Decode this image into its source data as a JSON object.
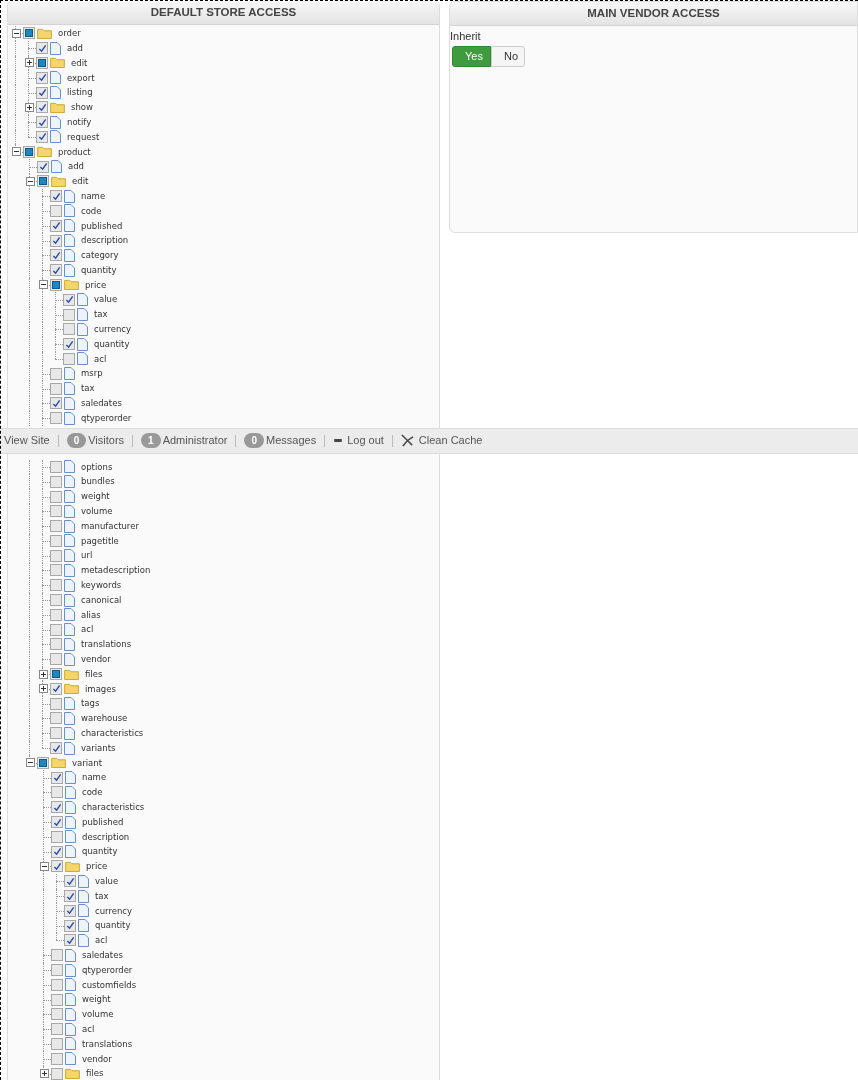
{
  "left_panel": {
    "title": "DEFAULT STORE ACCESS"
  },
  "tree": [
    {
      "kind": "folder",
      "label": "order",
      "checked": false,
      "partial": true,
      "expanded": true,
      "children": [
        {
          "kind": "file",
          "label": "add",
          "checked": true,
          "partial": false
        },
        {
          "kind": "folder",
          "label": "edit",
          "checked": false,
          "partial": true,
          "expanded": false
        },
        {
          "kind": "file",
          "label": "export",
          "checked": true,
          "partial": false
        },
        {
          "kind": "file",
          "label": "listing",
          "checked": true,
          "partial": false
        },
        {
          "kind": "folder",
          "label": "show",
          "checked": true,
          "partial": false,
          "expanded": false
        },
        {
          "kind": "file",
          "label": "notify",
          "checked": true,
          "partial": false
        },
        {
          "kind": "file",
          "label": "request",
          "checked": true,
          "partial": false
        }
      ]
    },
    {
      "kind": "folder",
      "label": "product",
      "checked": false,
      "partial": true,
      "expanded": true,
      "children": [
        {
          "kind": "file",
          "label": "add",
          "checked": true,
          "partial": false
        },
        {
          "kind": "folder",
          "label": "edit",
          "checked": false,
          "partial": true,
          "expanded": true,
          "children": [
            {
              "kind": "file",
              "label": "name",
              "checked": true,
              "partial": false
            },
            {
              "kind": "file",
              "label": "code",
              "checked": false,
              "partial": false
            },
            {
              "kind": "file",
              "label": "published",
              "checked": true,
              "partial": false
            },
            {
              "kind": "file",
              "label": "description",
              "checked": true,
              "partial": false
            },
            {
              "kind": "file",
              "label": "category",
              "checked": true,
              "partial": false
            },
            {
              "kind": "file",
              "label": "quantity",
              "checked": true,
              "partial": false
            },
            {
              "kind": "folder",
              "label": "price",
              "checked": false,
              "partial": true,
              "expanded": true,
              "children": [
                {
                  "kind": "file",
                  "label": "value",
                  "checked": true,
                  "partial": false
                },
                {
                  "kind": "file",
                  "label": "tax",
                  "checked": false,
                  "partial": false
                },
                {
                  "kind": "file",
                  "label": "currency",
                  "checked": false,
                  "partial": false
                },
                {
                  "kind": "file",
                  "label": "quantity",
                  "checked": true,
                  "partial": false
                },
                {
                  "kind": "file",
                  "label": "acl",
                  "checked": false,
                  "partial": false
                }
              ]
            },
            {
              "kind": "file",
              "label": "msrp",
              "checked": false,
              "partial": false
            },
            {
              "kind": "file",
              "label": "tax",
              "checked": false,
              "partial": false
            },
            {
              "kind": "file",
              "label": "saledates",
              "checked": true,
              "partial": false
            },
            {
              "kind": "file",
              "label": "qtyperorder",
              "checked": false,
              "partial": false
            },
            {
              "kind": "file",
              "label": "options",
              "checked": false,
              "partial": false
            },
            {
              "kind": "file",
              "label": "bundles",
              "checked": false,
              "partial": false
            },
            {
              "kind": "file",
              "label": "weight",
              "checked": false,
              "partial": false
            },
            {
              "kind": "file",
              "label": "volume",
              "checked": false,
              "partial": false
            },
            {
              "kind": "file",
              "label": "manufacturer",
              "checked": false,
              "partial": false
            },
            {
              "kind": "file",
              "label": "pagetitle",
              "checked": false,
              "partial": false
            },
            {
              "kind": "file",
              "label": "url",
              "checked": false,
              "partial": false
            },
            {
              "kind": "file",
              "label": "metadescription",
              "checked": false,
              "partial": false
            },
            {
              "kind": "file",
              "label": "keywords",
              "checked": false,
              "partial": false
            },
            {
              "kind": "file",
              "label": "canonical",
              "checked": false,
              "partial": false
            },
            {
              "kind": "file",
              "label": "alias",
              "checked": false,
              "partial": false
            },
            {
              "kind": "file",
              "label": "acl",
              "checked": false,
              "partial": false
            },
            {
              "kind": "file",
              "label": "translations",
              "checked": false,
              "partial": false
            },
            {
              "kind": "file",
              "label": "vendor",
              "checked": false,
              "partial": false
            },
            {
              "kind": "folder",
              "label": "files",
              "checked": false,
              "partial": true,
              "expanded": false
            },
            {
              "kind": "folder",
              "label": "images",
              "checked": true,
              "partial": false,
              "expanded": false
            },
            {
              "kind": "file",
              "label": "tags",
              "checked": false,
              "partial": false
            },
            {
              "kind": "file",
              "label": "warehouse",
              "checked": false,
              "partial": false
            },
            {
              "kind": "file",
              "label": "characteristics",
              "checked": false,
              "partial": false
            },
            {
              "kind": "file",
              "label": "variants",
              "checked": true,
              "partial": false
            }
          ]
        },
        {
          "kind": "folder",
          "label": "variant",
          "checked": false,
          "partial": true,
          "expanded": true,
          "children": [
            {
              "kind": "file",
              "label": "name",
              "checked": true,
              "partial": false
            },
            {
              "kind": "file",
              "label": "code",
              "checked": false,
              "partial": false
            },
            {
              "kind": "file",
              "label": "characteristics",
              "checked": true,
              "partial": false
            },
            {
              "kind": "file",
              "label": "published",
              "checked": true,
              "partial": false
            },
            {
              "kind": "file",
              "label": "description",
              "checked": false,
              "partial": false
            },
            {
              "kind": "file",
              "label": "quantity",
              "checked": true,
              "partial": false
            },
            {
              "kind": "folder",
              "label": "price",
              "checked": true,
              "partial": false,
              "expanded": true,
              "children": [
                {
                  "kind": "file",
                  "label": "value",
                  "checked": true,
                  "partial": false
                },
                {
                  "kind": "file",
                  "label": "tax",
                  "checked": true,
                  "partial": false
                },
                {
                  "kind": "file",
                  "label": "currency",
                  "checked": true,
                  "partial": false
                },
                {
                  "kind": "file",
                  "label": "quantity",
                  "checked": true,
                  "partial": false
                },
                {
                  "kind": "file",
                  "label": "acl",
                  "checked": true,
                  "partial": false
                }
              ]
            },
            {
              "kind": "file",
              "label": "saledates",
              "checked": false,
              "partial": false
            },
            {
              "kind": "file",
              "label": "qtyperorder",
              "checked": false,
              "partial": false
            },
            {
              "kind": "file",
              "label": "customfields",
              "checked": false,
              "partial": false
            },
            {
              "kind": "file",
              "label": "weight",
              "checked": false,
              "partial": false
            },
            {
              "kind": "file",
              "label": "volume",
              "checked": false,
              "partial": false
            },
            {
              "kind": "file",
              "label": "acl",
              "checked": false,
              "partial": false
            },
            {
              "kind": "file",
              "label": "translations",
              "checked": false,
              "partial": false
            },
            {
              "kind": "file",
              "label": "vendor",
              "checked": false,
              "partial": false
            },
            {
              "kind": "folder",
              "label": "files",
              "checked": false,
              "partial": false,
              "expanded": false
            }
          ]
        }
      ]
    }
  ],
  "right_panel": {
    "title": "MAIN VENDOR ACCESS",
    "inherit": {
      "label": "Inherit",
      "options": [
        {
          "label": "Yes",
          "selected": true
        },
        {
          "label": "No",
          "selected": false
        }
      ]
    }
  },
  "status_bar": {
    "items": [
      {
        "kind": "link",
        "label": "View Site"
      },
      {
        "kind": "badge",
        "count": "0",
        "label": "Visitors"
      },
      {
        "kind": "badge",
        "count": "1",
        "label": "Administrator"
      },
      {
        "kind": "badge",
        "count": "0",
        "label": "Messages"
      },
      {
        "kind": "logout",
        "label": "Log out"
      },
      {
        "kind": "cache",
        "label": "Clean Cache"
      }
    ]
  }
}
